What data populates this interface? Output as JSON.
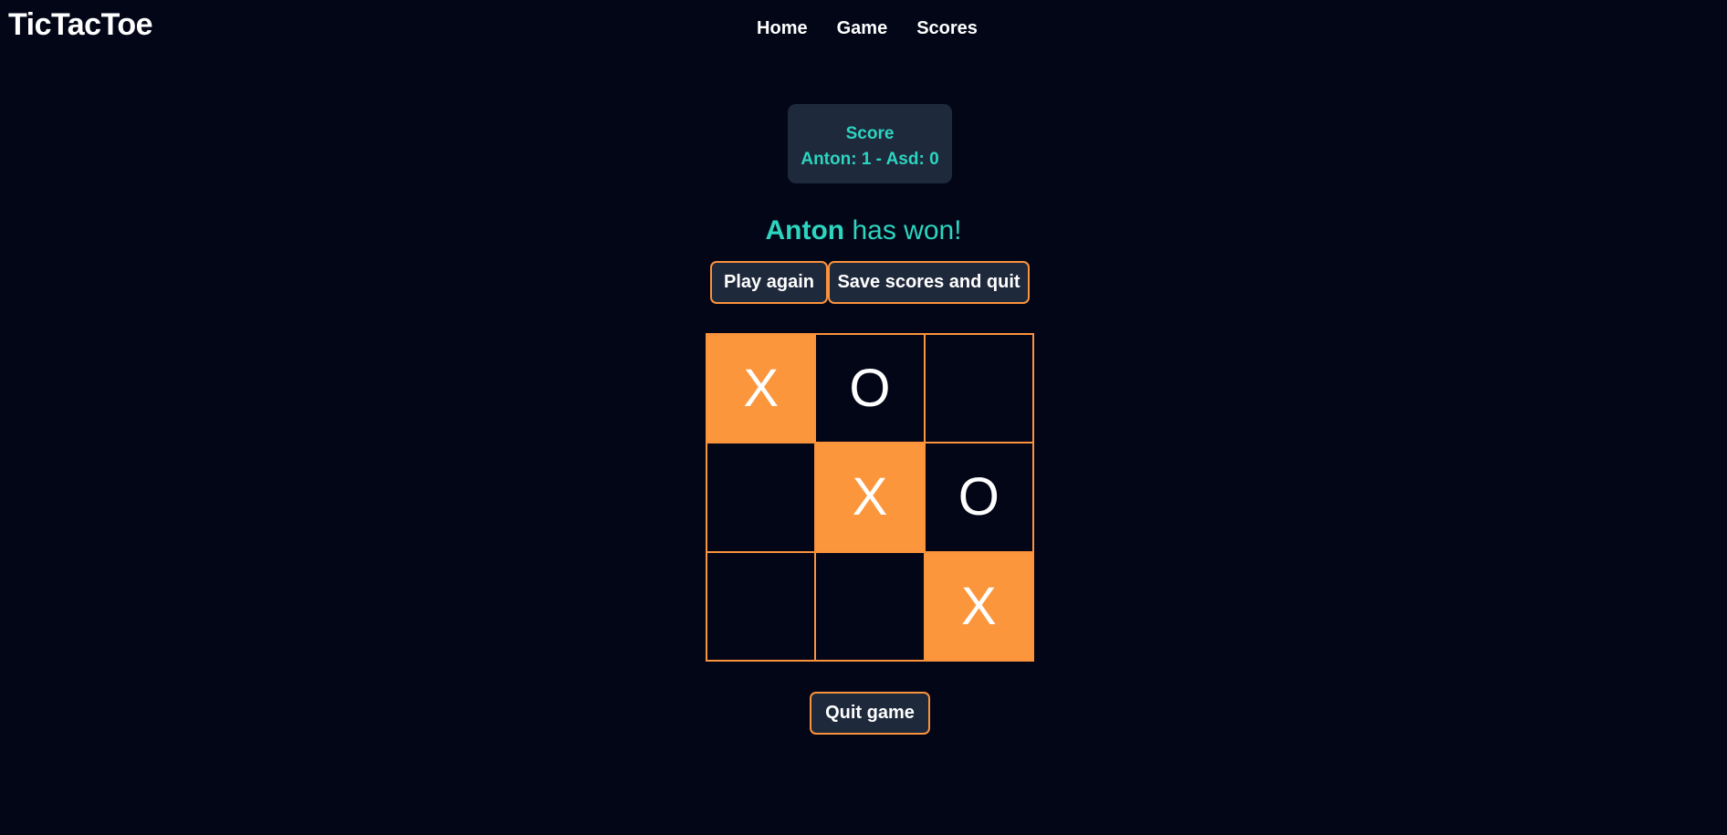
{
  "header": {
    "logo": "TicTacToe",
    "nav": [
      "Home",
      "Game",
      "Scores"
    ]
  },
  "score": {
    "title": "Score",
    "line": "Anton: 1 - Asd: 0"
  },
  "status": {
    "winner": "Anton",
    "suffix": " has won!"
  },
  "buttons": {
    "play_again": "Play again",
    "save_quit": "Save scores and quit",
    "quit_game": "Quit game"
  },
  "board": {
    "cells": [
      "X",
      "O",
      "",
      "",
      "X",
      "O",
      "",
      "",
      "X"
    ],
    "winning_cells": [
      0,
      4,
      8
    ]
  },
  "colors": {
    "background": "#020617",
    "accent": "#fb923c",
    "teal": "#2dd4bf",
    "panel": "#1e293b"
  }
}
